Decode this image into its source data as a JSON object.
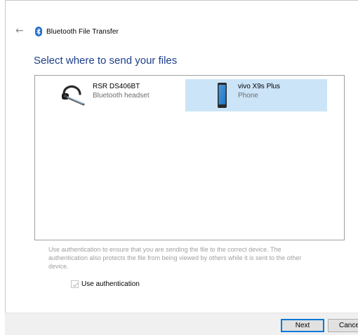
{
  "window": {
    "title": "Bluetooth File Transfer"
  },
  "heading": "Select where to send your files",
  "devices": [
    {
      "name": "RSR DS406BT",
      "type": "Bluetooth headset",
      "icon": "headset-icon",
      "selected": false
    },
    {
      "name": "vivo X9s Plus",
      "type": "Phone",
      "icon": "phone-icon",
      "selected": true
    }
  ],
  "authentication": {
    "description": "Use authentication to ensure that you are sending the file to the correct device. The authentication also protects the file from being viewed by others while it is sent to the other device.",
    "checkbox_label": "Use authentication",
    "checked": true
  },
  "buttons": {
    "next": "Next",
    "cancel": "Cancel"
  },
  "colors": {
    "heading": "#1c3e8a",
    "selection": "#cce4f7",
    "bluetooth": "#1f6fd1"
  }
}
